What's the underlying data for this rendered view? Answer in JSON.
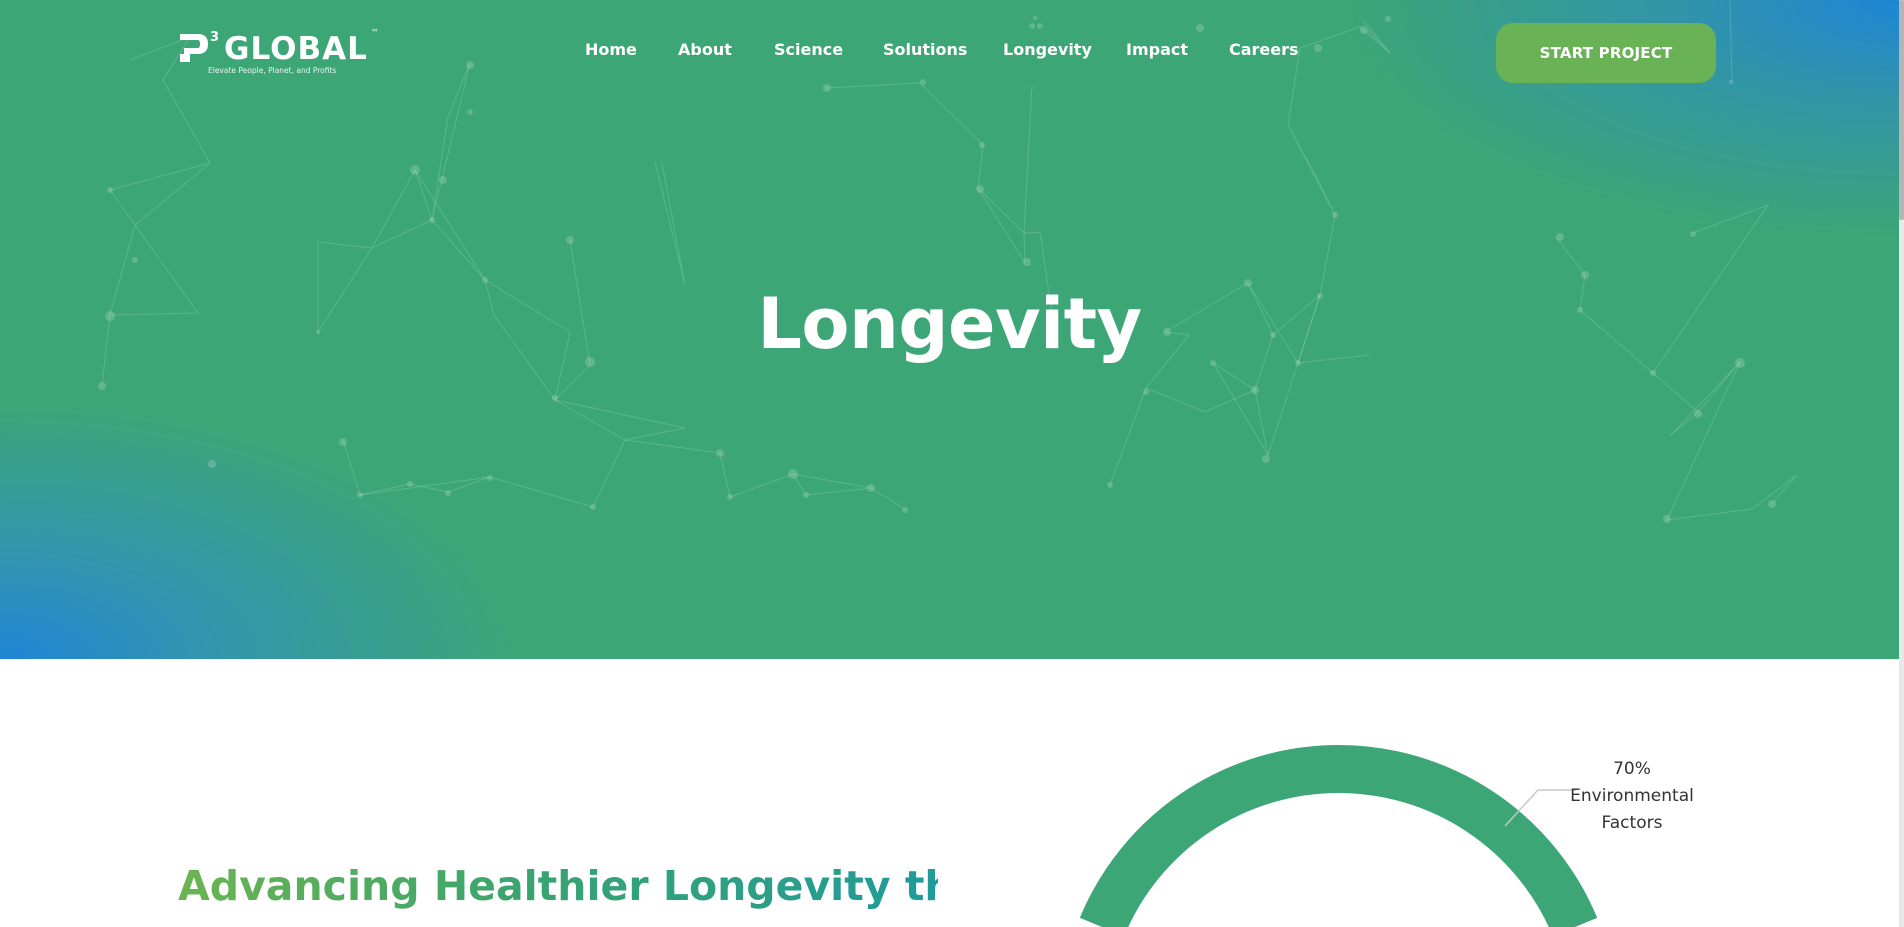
{
  "logo": {
    "wordmark": "GLOBAL",
    "superscript": "3",
    "trademark": "™",
    "tagline": "Elevate People, Planet, and Profits"
  },
  "nav": {
    "items": [
      "Home",
      "About",
      "Science",
      "Solutions",
      "Longevity",
      "Impact",
      "Careers"
    ],
    "cta": "START PROJECT"
  },
  "hero": {
    "title": "Longevity"
  },
  "section": {
    "heading": "Advancing Healthier Longevity through the Built Environment"
  },
  "chart": {
    "label_value": "70%",
    "label_line1": "Environmental",
    "label_line2": "Factors"
  },
  "colors": {
    "hero_green": "#3da676",
    "accent_blue": "#1e86d6",
    "cta_green": "#69b256",
    "donut_green": "#3da676"
  }
}
